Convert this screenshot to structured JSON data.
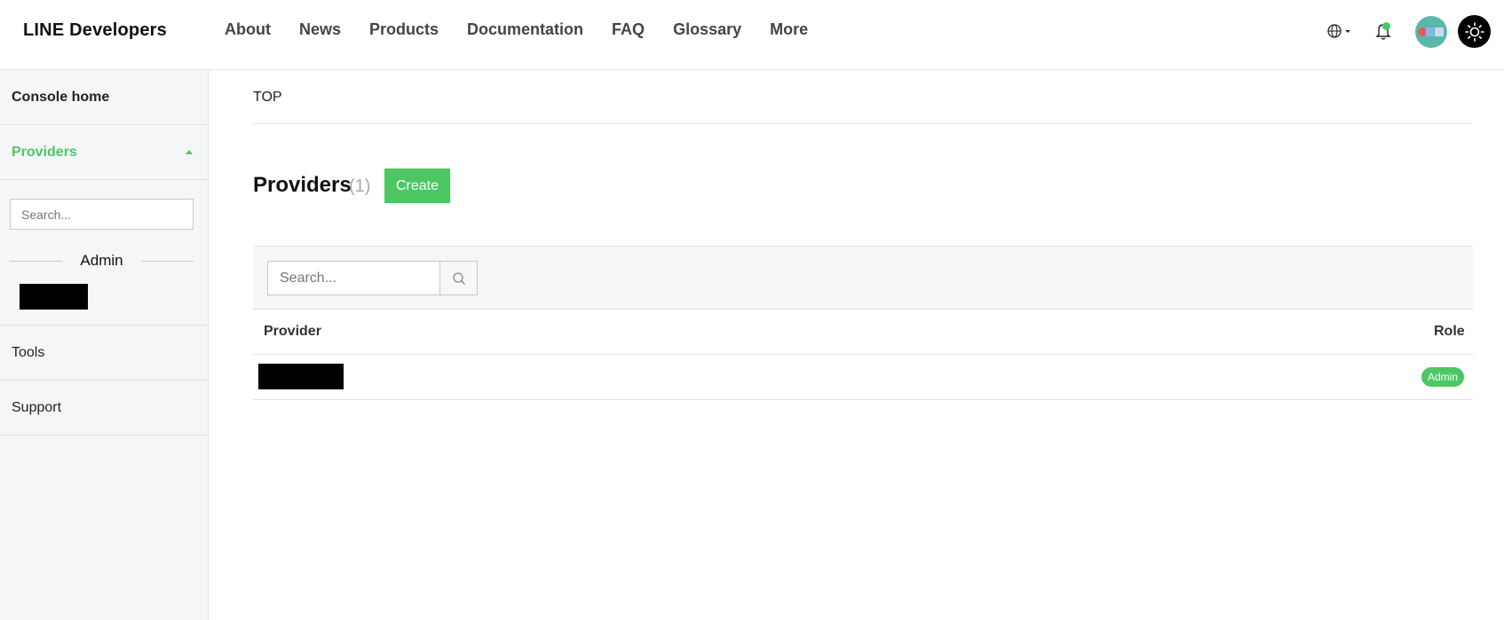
{
  "header": {
    "logo": "LINE Developers",
    "nav": [
      "About",
      "News",
      "Products",
      "Documentation",
      "FAQ",
      "Glossary",
      "More"
    ]
  },
  "sidebar": {
    "console_home": "Console home",
    "providers": "Providers",
    "search_placeholder": "Search...",
    "group_label": "Admin",
    "tools": "Tools",
    "support": "Support"
  },
  "main": {
    "breadcrumb": "TOP",
    "title": "Providers",
    "count": "(1)",
    "create_label": "Create",
    "search_placeholder": "Search...",
    "columns": {
      "provider": "Provider",
      "role": "Role"
    },
    "rows": [
      {
        "role": "Admin"
      }
    ]
  },
  "colors": {
    "accent": "#4cc764"
  }
}
